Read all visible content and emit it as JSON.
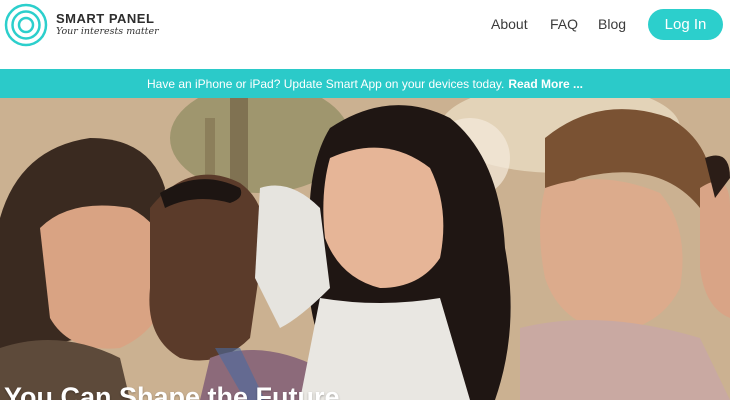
{
  "brand": {
    "name": "SMART PANEL",
    "tagline": "Your interests matter"
  },
  "nav": {
    "items": [
      "About",
      "FAQ",
      "Blog"
    ],
    "login_label": "Log In"
  },
  "banner": {
    "text": "Have an iPhone or iPad? Update Smart App on your devices today.",
    "link_label": "Read More ..."
  },
  "hero": {
    "image_icon": "group-of-friends-photo",
    "heading": "You Can Shape the Future"
  },
  "colors": {
    "accent": "#2ccfcc",
    "banner_bg": "#2bcac9",
    "text_dark": "#3b3b3b"
  }
}
